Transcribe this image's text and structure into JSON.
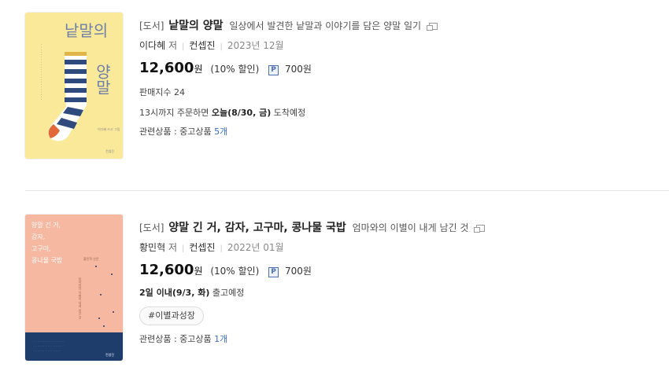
{
  "items": [
    {
      "category": "[도서]",
      "title": "낱말의 양말",
      "subtitle": "일상에서 발견한 낱말과 이야기를 담은 양말 일기",
      "author": "이다혜",
      "author_role": "저",
      "publisher": "컨셉진",
      "date": "2023년 12월",
      "price": "12,600",
      "won": "원",
      "discount": "(10% 할인)",
      "point_badge": "P",
      "point": "700원",
      "sales_index": "판매지수 24",
      "delivery_prefix": "13시까지 주문하면",
      "delivery_date": "오늘(8/30, 금)",
      "delivery_suffix": "도착예정",
      "related_label": "관련상품 : 중고상품",
      "related_count": "5개",
      "cover": {
        "title_top": "낱말의",
        "title_bottom": "양말",
        "author_small": "이다혜 쓰고 그림",
        "publisher_small": "컨셉진",
        "colors": {
          "background": "#fbe99a",
          "stripe_navy": "#2f4a7d",
          "stripe_white": "#ffffff",
          "heel": "#e2683c"
        }
      }
    },
    {
      "category": "[도서]",
      "title": "양말 긴 거, 감자, 고구마, 콩나물 국밥",
      "subtitle": "엄마와의 이별이 내게 남긴 것",
      "author": "황민혁",
      "author_role": "저",
      "publisher": "컨셉진",
      "date": "2022년 01월",
      "price": "12,600",
      "won": "원",
      "discount": "(10% 할인)",
      "point_badge": "P",
      "point": "700원",
      "delivery_date": "2일 이내(9/3, 화)",
      "delivery_suffix": "출고예정",
      "tag": "#이별과성장",
      "related_label": "관련상품 : 중고상품",
      "related_count": "1개",
      "cover": {
        "title_lines": [
          "양말 긴 거,",
          "감자,",
          "고구마,",
          "콩나물 국밥"
        ],
        "author_small": "황민혁 산문",
        "subtitle_small": "엄마와의 이별이 내게 남긴 것",
        "publisher_small": "컨셉진",
        "colors": {
          "background": "#f6b8a0",
          "sea": "#1f3d6b",
          "text": "#e8f0ff"
        }
      }
    }
  ]
}
